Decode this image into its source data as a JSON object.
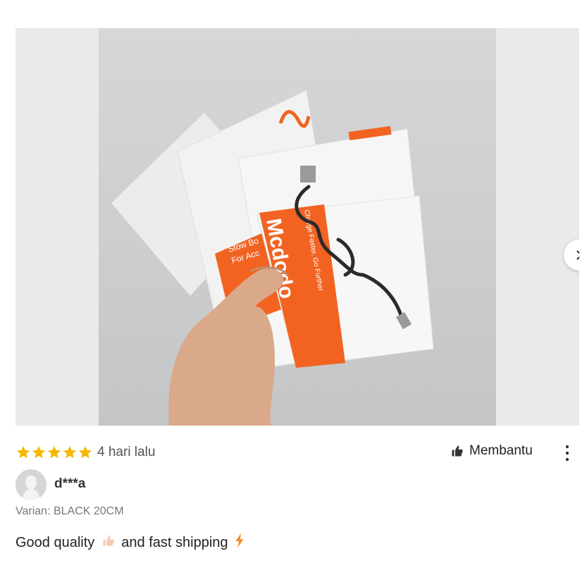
{
  "photo": {
    "packaging_brand_top": "Mcdodo",
    "packaging_text_1": "Stow Bo",
    "packaging_text_2": "For Acc",
    "packaging_tagline": "Charge Faster, Go Further"
  },
  "rating": {
    "stars": 5,
    "max_stars": 5,
    "time_ago": "4 hari lalu"
  },
  "helpful_label": "Membantu",
  "user": {
    "name": "d***a"
  },
  "variant_text": "Varian: BLACK 20CM",
  "review": {
    "text_before": "Good quality",
    "text_after": "and fast shipping"
  },
  "colors": {
    "star": "#f5b800",
    "text": "#222222",
    "muted": "#777777",
    "orange": "#f26322"
  },
  "icons": [
    "star-icon",
    "thumbs-up-icon",
    "more-vertical-icon",
    "chevron-right-icon",
    "thumbs-up-emoji-icon",
    "lightning-emoji-icon"
  ]
}
